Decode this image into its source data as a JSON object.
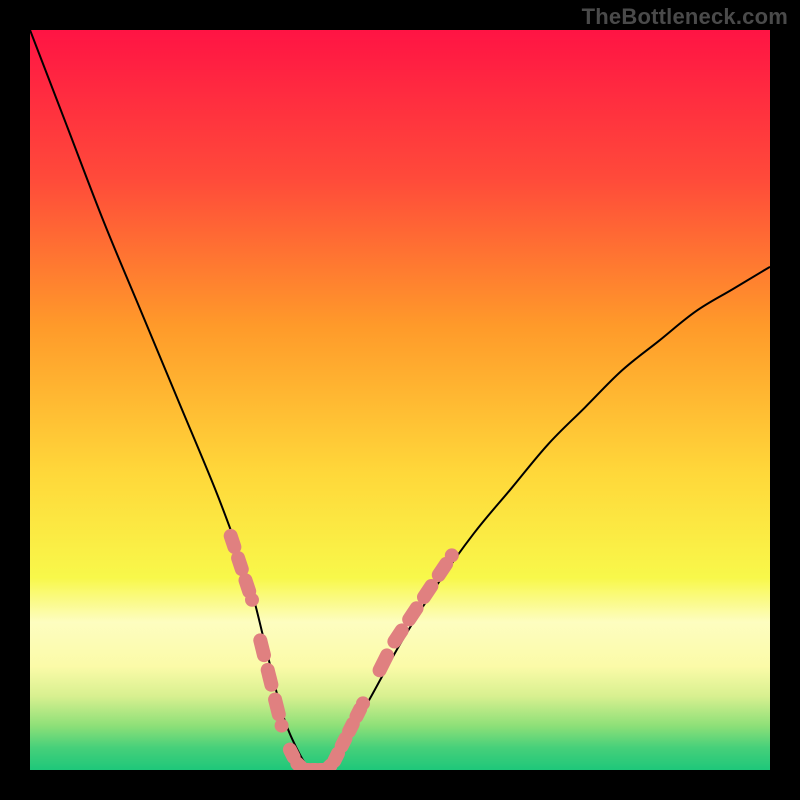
{
  "watermark": "TheBottleneck.com",
  "chart_data": {
    "type": "line",
    "title": "",
    "xlabel": "",
    "ylabel": "",
    "xlim": [
      0,
      100
    ],
    "ylim": [
      0,
      100
    ],
    "grid": false,
    "legend": false,
    "annotations": [],
    "series": [
      {
        "name": "bottleneck-curve",
        "color": "#000000",
        "x": [
          0,
          5,
          10,
          15,
          20,
          25,
          28,
          30,
          32,
          34,
          36,
          38,
          40,
          45,
          50,
          55,
          60,
          65,
          70,
          75,
          80,
          85,
          90,
          95,
          100
        ],
        "values": [
          100,
          87,
          74,
          62,
          50,
          38,
          30,
          24,
          16,
          8,
          3,
          0,
          0,
          8,
          17,
          25,
          32,
          38,
          44,
          49,
          54,
          58,
          62,
          65,
          68
        ]
      },
      {
        "name": "highlight-left-upper",
        "style": "thick-dashed",
        "color": "#e08080",
        "x": [
          27,
          28,
          29,
          30
        ],
        "values": [
          32,
          29,
          26,
          23
        ]
      },
      {
        "name": "highlight-left-lower",
        "style": "thick-dashed",
        "color": "#e08080",
        "x": [
          31,
          32,
          33,
          34
        ],
        "values": [
          18,
          14,
          10,
          6
        ]
      },
      {
        "name": "highlight-valley",
        "style": "thick-dashed",
        "color": "#e08080",
        "x": [
          35,
          36,
          37,
          38,
          39,
          40,
          41,
          42,
          43,
          44,
          45
        ],
        "values": [
          3,
          1,
          0,
          0,
          0,
          0,
          1,
          3,
          5,
          7,
          9
        ]
      },
      {
        "name": "highlight-right",
        "style": "thick-dashed",
        "color": "#e08080",
        "x": [
          47,
          49,
          51,
          53,
          55,
          57
        ],
        "values": [
          13,
          17,
          20,
          23,
          26,
          29
        ]
      }
    ],
    "background_gradient": {
      "direction": "vertical",
      "stops": [
        {
          "offset": 0.0,
          "color": "#ff1444"
        },
        {
          "offset": 0.2,
          "color": "#ff4a3a"
        },
        {
          "offset": 0.4,
          "color": "#ff9a2a"
        },
        {
          "offset": 0.6,
          "color": "#ffd83a"
        },
        {
          "offset": 0.74,
          "color": "#f8f84a"
        },
        {
          "offset": 0.8,
          "color": "#fdfdc0"
        },
        {
          "offset": 0.86,
          "color": "#fbfba8"
        },
        {
          "offset": 0.9,
          "color": "#d8f090"
        },
        {
          "offset": 0.94,
          "color": "#8ee078"
        },
        {
          "offset": 0.97,
          "color": "#46d07a"
        },
        {
          "offset": 1.0,
          "color": "#1ec77a"
        }
      ]
    }
  }
}
